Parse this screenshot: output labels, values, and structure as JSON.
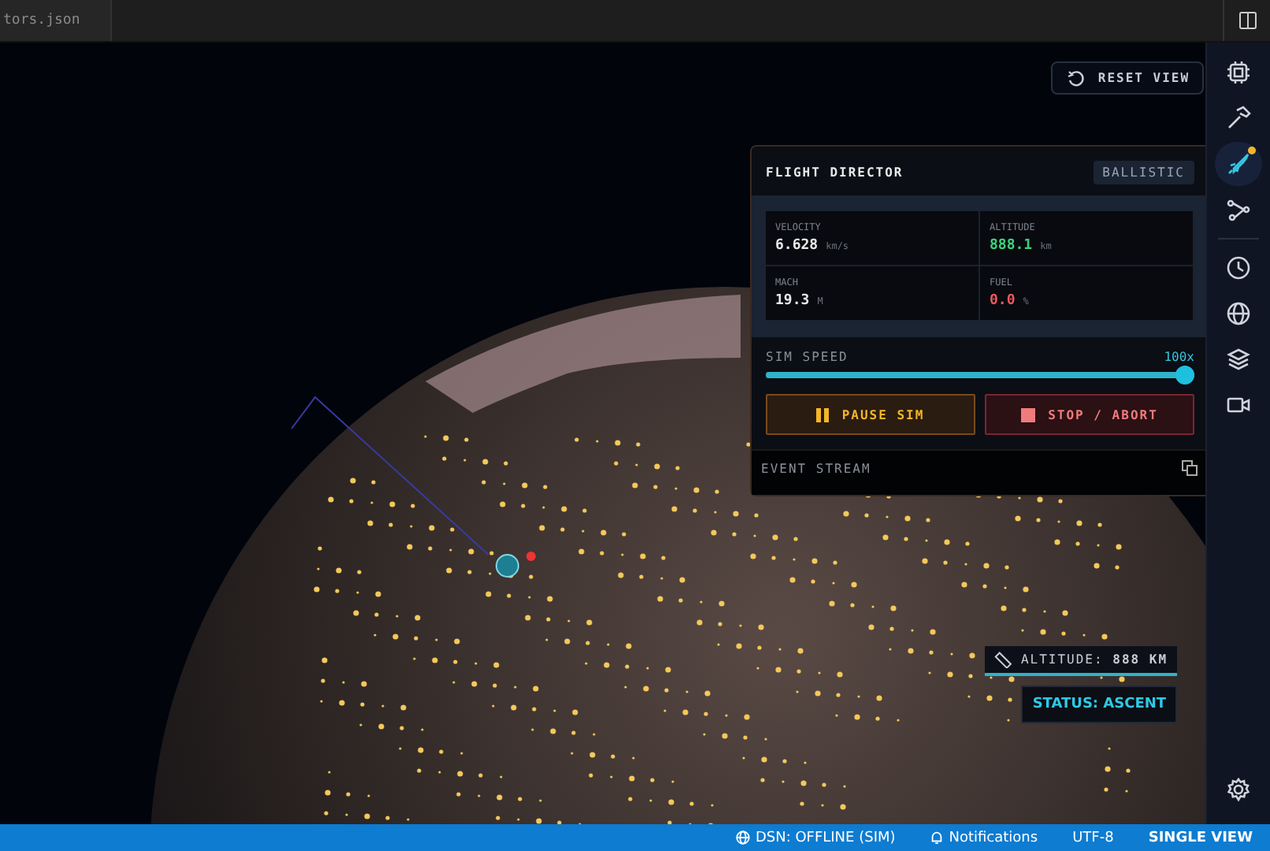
{
  "tab": {
    "label": "tors.json"
  },
  "reset_button": {
    "label": "RESET VIEW"
  },
  "flight_director": {
    "title": "FLIGHT DIRECTOR",
    "mode": "BALLISTIC",
    "metrics": [
      {
        "label": "VELOCITY",
        "value": "6.628",
        "unit": "km/s",
        "color": "#e8e8e8"
      },
      {
        "label": "ALTITUDE",
        "value": "888.1",
        "unit": "km",
        "color": "#3ed07a"
      },
      {
        "label": "MACH",
        "value": "19.3",
        "unit": "M",
        "color": "#e8e8e8"
      },
      {
        "label": "FUEL",
        "value": "0.0",
        "unit": "%",
        "color": "#f05a5a"
      }
    ],
    "sim_speed": {
      "label": "SIM SPEED",
      "reading": "100x",
      "level": 1
    },
    "buttons": [
      {
        "kind": "pause",
        "label": "PAUSE SIM"
      },
      {
        "kind": "stop",
        "label": "STOP / ABORT"
      }
    ],
    "event_stream": {
      "label": "EVENT STREAM"
    }
  },
  "overlay": {
    "altitude": "ALTITUDE: **888 KM**",
    "status": "STATUS: ASCENT"
  },
  "sidebar": {
    "items": [
      {
        "kind": "chip",
        "selected": false,
        "badge": false
      },
      {
        "kind": "hammer",
        "selected": false,
        "badge": false
      },
      {
        "kind": "rocket",
        "selected": true,
        "badge": true
      },
      {
        "kind": "nodes",
        "selected": false,
        "badge": false
      },
      {
        "kind": "clock",
        "selected": false,
        "badge": false
      },
      {
        "kind": "globe",
        "selected": false,
        "badge": false
      },
      {
        "kind": "layers",
        "selected": false,
        "badge": false
      },
      {
        "kind": "video",
        "selected": false,
        "badge": false
      },
      {
        "kind": "settings",
        "selected": false,
        "badge": false
      }
    ]
  },
  "status_bar": {
    "items": [
      {
        "kind": "dsn",
        "label": "DSN: OFFLINE (SIM)"
      },
      {
        "kind": "bell",
        "label": "Notifications"
      },
      {
        "kind": "plain",
        "label": "UTF-8"
      },
      {
        "kind": "strong",
        "label": "SINGLE VIEW"
      }
    ]
  }
}
